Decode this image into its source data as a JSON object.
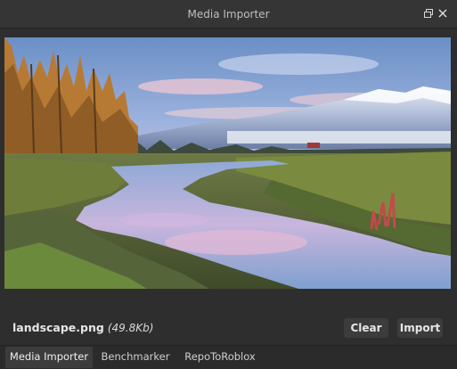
{
  "window": {
    "title": "Media Importer"
  },
  "file": {
    "name": "landscape.png",
    "size": "(49.8Kb)"
  },
  "actions": {
    "clear_label": "Clear",
    "import_label": "Import"
  },
  "tabs": [
    {
      "label": "Media Importer",
      "active": true
    },
    {
      "label": "Benchmarker",
      "active": false
    },
    {
      "label": "RepoToRoblox",
      "active": false
    }
  ],
  "icons": {
    "restore": "restore-window-icon",
    "close": "close-icon"
  },
  "colors": {
    "window_bg": "#2e2e2e",
    "titlebar_bg": "#353535",
    "button_bg": "#3c3c3c",
    "text": "#e6e6e6"
  }
}
